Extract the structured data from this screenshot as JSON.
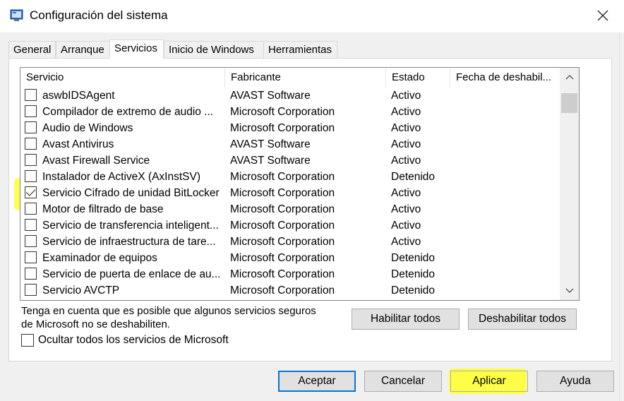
{
  "window": {
    "title": "Configuración del sistema"
  },
  "tabs": [
    {
      "label": "General"
    },
    {
      "label": "Arranque"
    },
    {
      "label": "Servicios"
    },
    {
      "label": "Inicio de Windows"
    },
    {
      "label": "Herramientas"
    }
  ],
  "active_tab": "Servicios",
  "columns": [
    {
      "label": "Servicio"
    },
    {
      "label": "Fabricante"
    },
    {
      "label": "Estado"
    },
    {
      "label": "Fecha de deshabil..."
    }
  ],
  "services": [
    {
      "name": "aswbIDSAgent",
      "maker": "AVAST Software",
      "status": "Activo",
      "checked": false
    },
    {
      "name": "Compilador de extremo de audio ...",
      "maker": "Microsoft Corporation",
      "status": "Activo",
      "checked": false
    },
    {
      "name": "Audio de Windows",
      "maker": "Microsoft Corporation",
      "status": "Activo",
      "checked": false
    },
    {
      "name": "Avast Antivirus",
      "maker": "AVAST Software",
      "status": "Activo",
      "checked": false
    },
    {
      "name": "Avast Firewall Service",
      "maker": "AVAST Software",
      "status": "Activo",
      "checked": false
    },
    {
      "name": "Instalador de ActiveX (AxInstSV)",
      "maker": "Microsoft Corporation",
      "status": "Detenido",
      "checked": false
    },
    {
      "name": "Servicio Cifrado de unidad BitLocker",
      "maker": "Microsoft Corporation",
      "status": "Activo",
      "checked": true
    },
    {
      "name": "Motor de filtrado de base",
      "maker": "Microsoft Corporation",
      "status": "Activo",
      "checked": false
    },
    {
      "name": "Servicio de transferencia inteligent...",
      "maker": "Microsoft Corporation",
      "status": "Activo",
      "checked": false
    },
    {
      "name": "Servicio de infraestructura de tare...",
      "maker": "Microsoft Corporation",
      "status": "Activo",
      "checked": false
    },
    {
      "name": "Examinador de equipos",
      "maker": "Microsoft Corporation",
      "status": "Detenido",
      "checked": false
    },
    {
      "name": "Servicio de puerta de enlace de au...",
      "maker": "Microsoft Corporation",
      "status": "Detenido",
      "checked": false
    },
    {
      "name": "Servicio AVCTP",
      "maker": "Microsoft Corporation",
      "status": "Detenido",
      "checked": false
    }
  ],
  "note": "Tenga en cuenta que es posible que algunos servicios seguros de Microsoft no se deshabiliten.",
  "buttons": {
    "enable_all": "Habilitar todos",
    "disable_all": "Deshabilitar todos",
    "ok": "Aceptar",
    "cancel": "Cancelar",
    "apply": "Aplicar",
    "help": "Ayuda"
  },
  "hide_ms_label": "Ocultar todos los servicios de Microsoft",
  "colors": {
    "highlight": "#ffff33",
    "accent": "#0078d7"
  },
  "icons": {
    "close": "close-icon",
    "app": "msconfig-icon",
    "scroll_up": "chevron-up-icon",
    "scroll_down": "chevron-down-icon",
    "check": "checkmark-icon"
  }
}
